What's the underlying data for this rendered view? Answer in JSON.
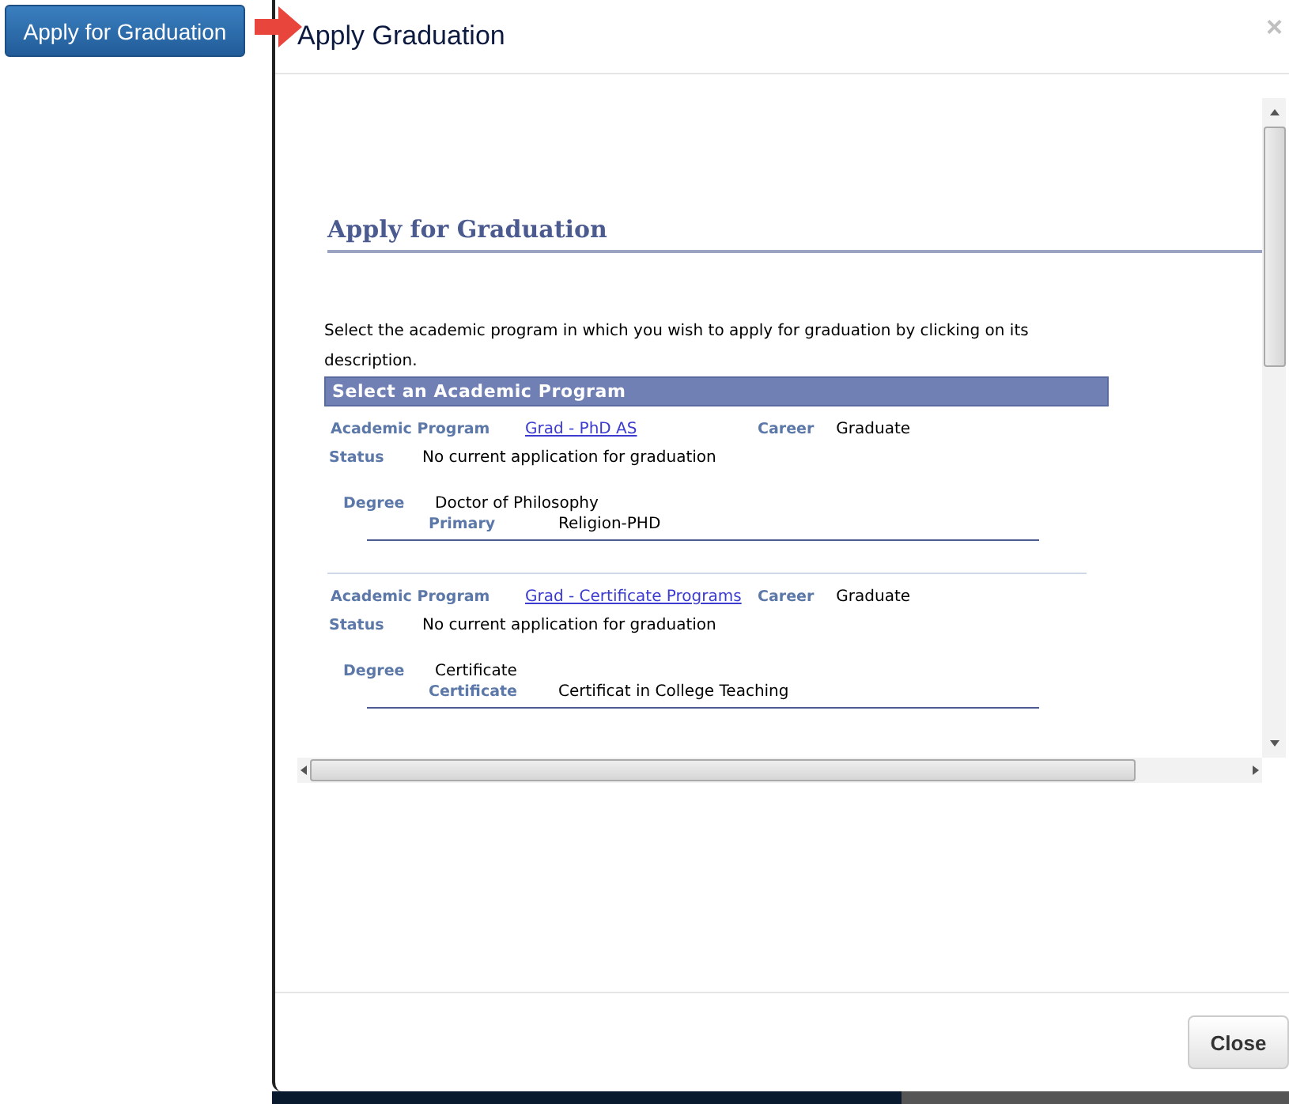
{
  "page_button": "Apply for Graduation",
  "dialog": {
    "title": "Apply Graduation",
    "close_icon": "×",
    "close_button": "Close"
  },
  "content": {
    "heading": "Apply for Graduation",
    "instructions": "Select the academic program in which you wish to apply for graduation by clicking on its description.",
    "table_header": "Select an Academic Program",
    "programs": [
      {
        "program_label": "Academic Program",
        "program": "Grad - PhD AS",
        "career_label": "Career",
        "career": "Graduate",
        "status_label": "Status",
        "status": "No current application for graduation",
        "degree_label": "Degree",
        "degree": "Doctor of Philosophy",
        "plan_label": "Primary",
        "plan": "Religion-PHD"
      },
      {
        "program_label": "Academic Program",
        "program": "Grad - Certificate Programs",
        "career_label": "Career",
        "career": "Graduate",
        "status_label": "Status",
        "status": "No current application for graduation",
        "degree_label": "Degree",
        "degree": "Certificate",
        "plan_label": "Certificate",
        "plan": "Certificat in College Teaching"
      }
    ]
  }
}
